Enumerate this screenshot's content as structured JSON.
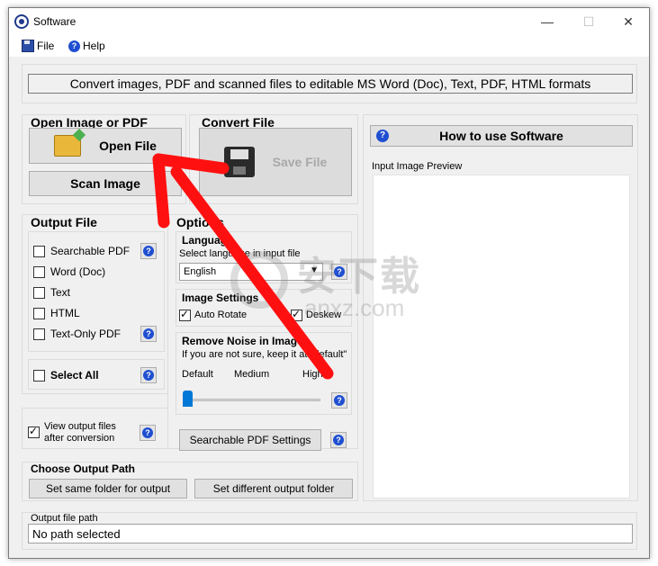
{
  "window": {
    "title": "Software",
    "minimize": "—",
    "maximize": "☐",
    "close": "✕"
  },
  "menu": {
    "file": "File",
    "help": "Help"
  },
  "banner": "Convert images, PDF and scanned files to editable MS Word (Doc), Text, PDF, HTML formats",
  "open_group": {
    "title": "Open Image or PDF",
    "open_file": "Open File",
    "scan_image": "Scan Image"
  },
  "convert_group": {
    "title": "Convert File",
    "save_file": "Save File"
  },
  "how_to": "How to use Software",
  "preview": {
    "title": "Input Image Preview"
  },
  "output_file": {
    "title": "Output File",
    "items": [
      {
        "label": "Searchable PDF",
        "checked": false
      },
      {
        "label": "Word (Doc)",
        "checked": false
      },
      {
        "label": "Text",
        "checked": false
      },
      {
        "label": "HTML",
        "checked": false
      },
      {
        "label": "Text-Only PDF",
        "checked": false
      }
    ],
    "select_all": "Select All"
  },
  "view_output": {
    "line1": "View output files",
    "line2": "after conversion",
    "checked": true
  },
  "options": {
    "title": "Options",
    "language": {
      "title": "Language",
      "hint": "Select language in input file",
      "value": "English"
    },
    "image_settings": {
      "title": "Image Settings",
      "auto_rotate": "Auto Rotate",
      "deskew": "Deskew",
      "auto_rotate_checked": true,
      "deskew_checked": true
    },
    "noise": {
      "title": "Remove Noise in Image",
      "hint": "If you are not sure, keep it at \"default\"",
      "default": "Default",
      "medium": "Medium",
      "high": "High",
      "level": 0
    },
    "pdf_settings": "Searchable PDF Settings"
  },
  "output_path": {
    "title": "Choose Output Path",
    "same_folder": "Set same folder for output",
    "different_folder": "Set different output folder"
  },
  "file_path": {
    "title": "Output file path",
    "value": "No path selected"
  },
  "watermark": {
    "cn": "安下载",
    "en": "anxz.com"
  }
}
